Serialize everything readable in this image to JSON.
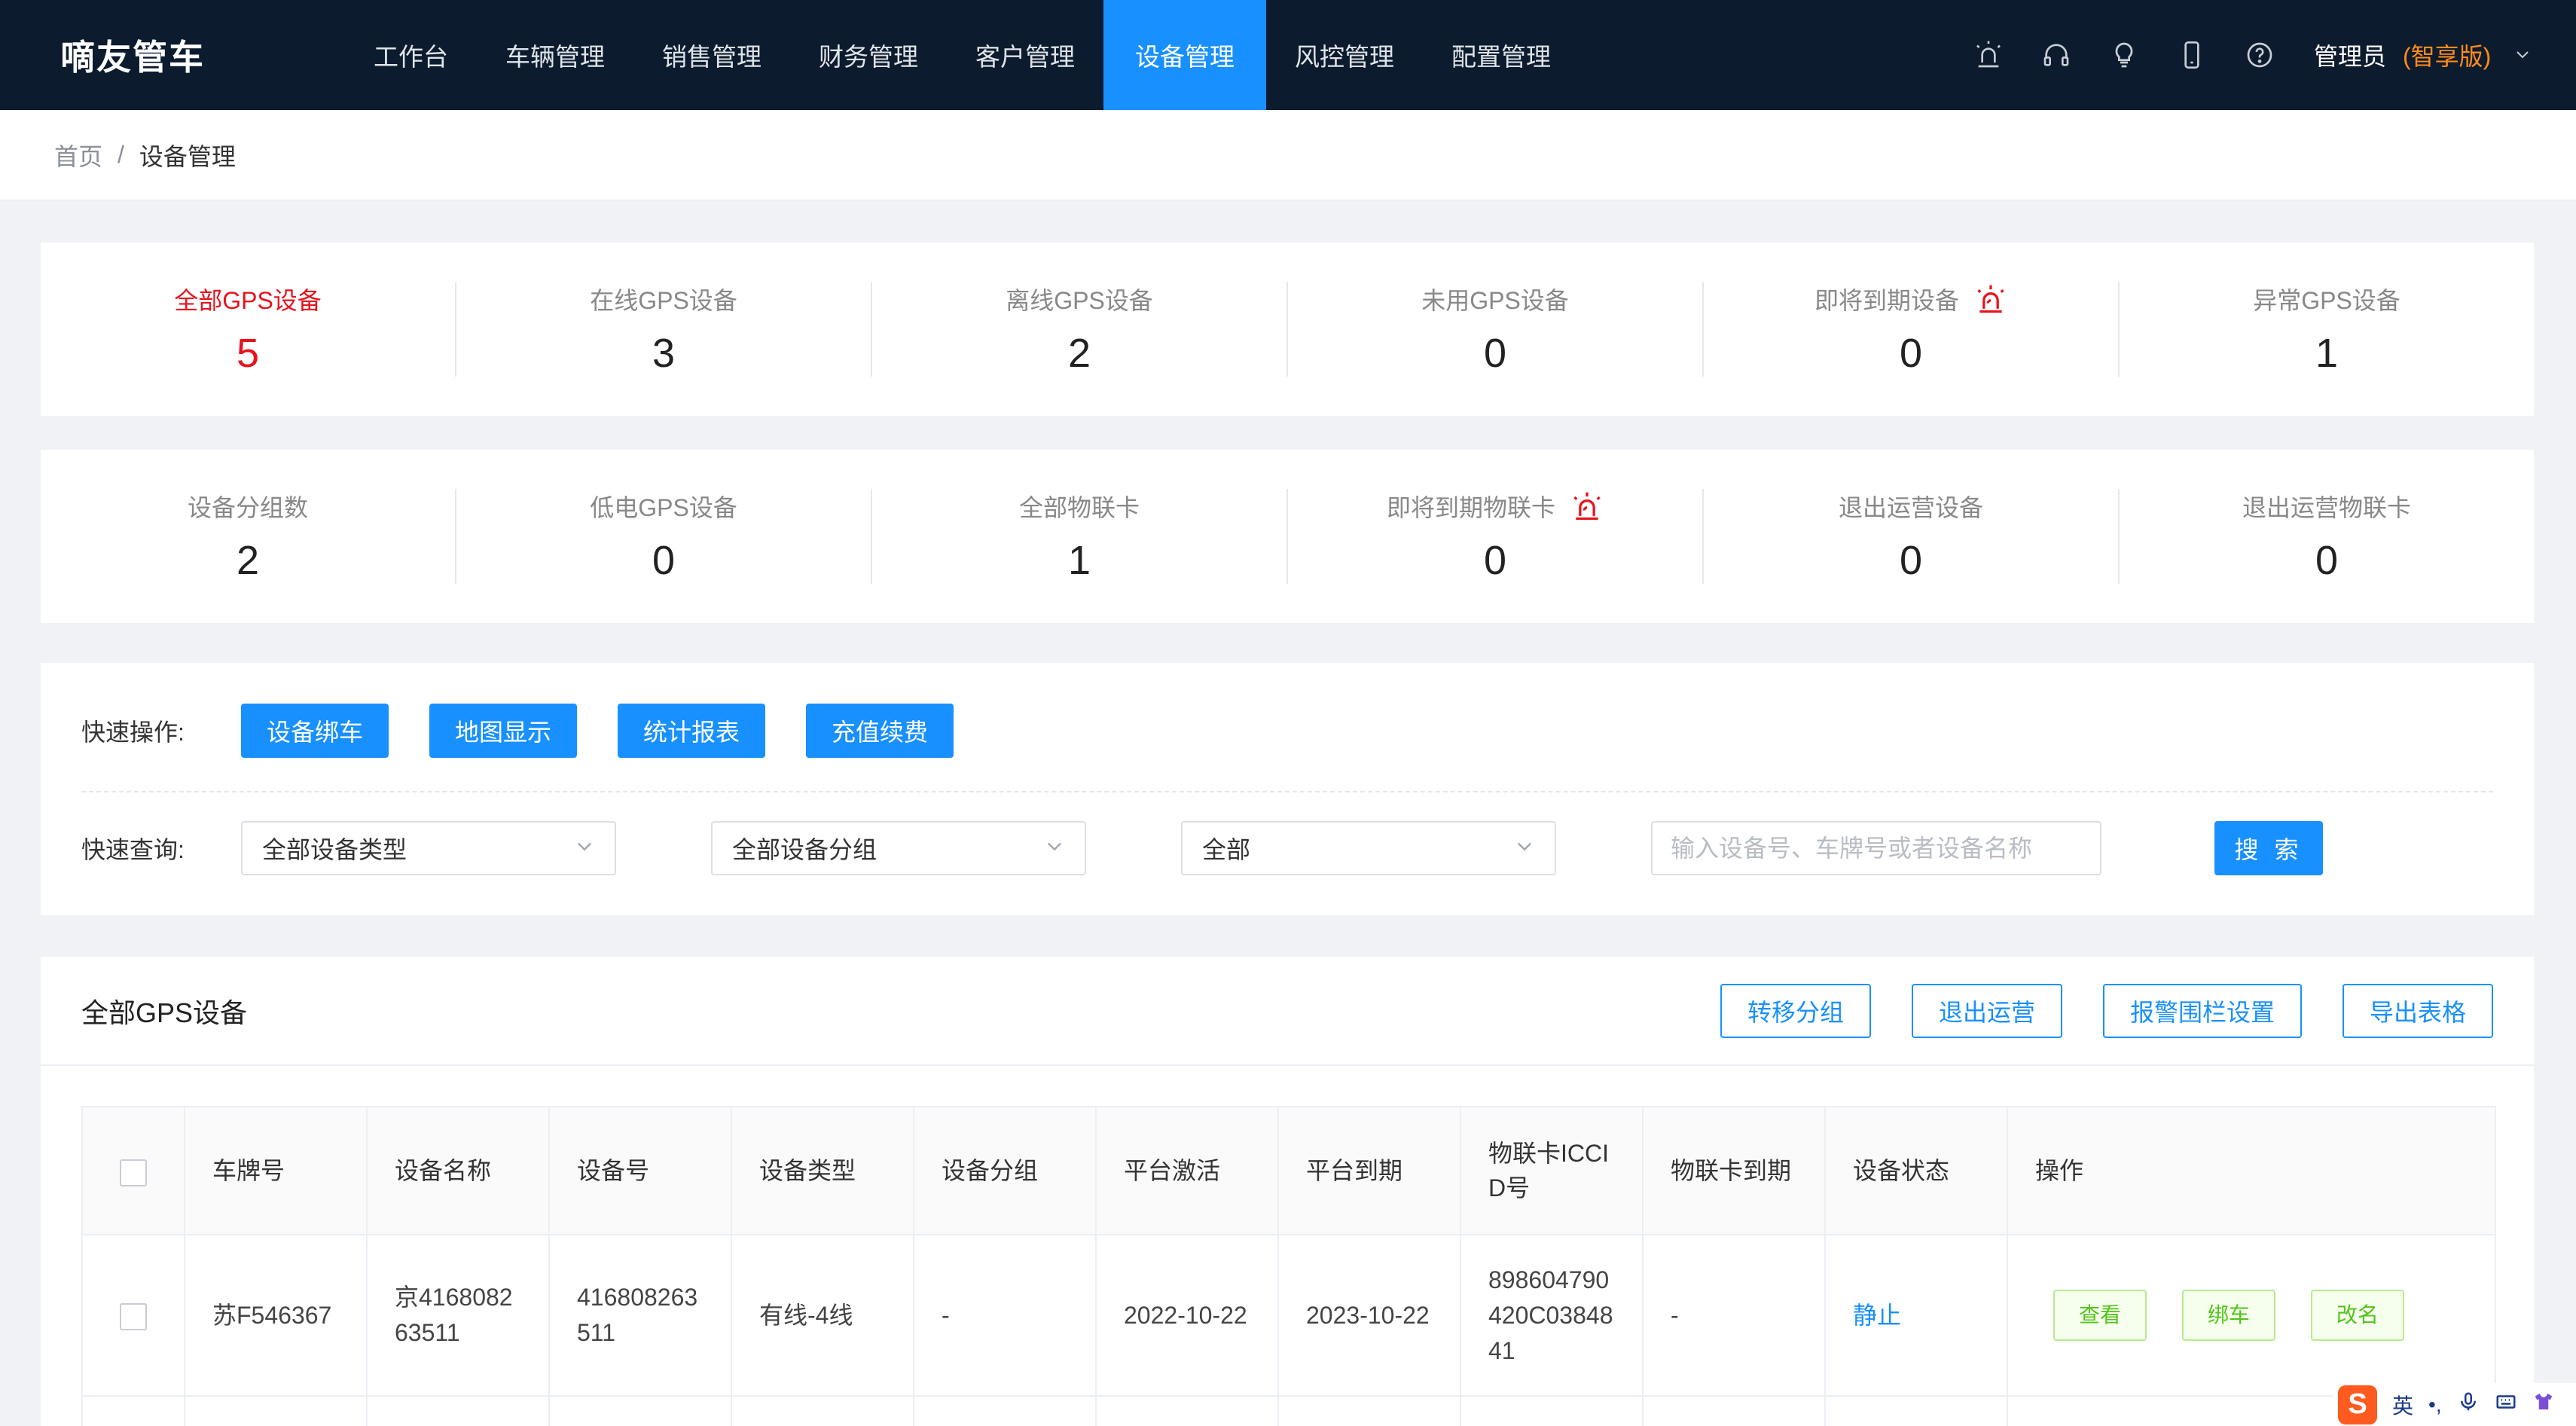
{
  "app": {
    "brand": "嘀友管车"
  },
  "nav": {
    "items": [
      "工作台",
      "车辆管理",
      "销售管理",
      "财务管理",
      "客户管理",
      "设备管理",
      "风控管理",
      "配置管理"
    ],
    "active_index": 5
  },
  "header": {
    "icons": [
      "alarm-icon",
      "headset-icon",
      "lightbulb-icon",
      "phone-icon",
      "help-icon"
    ],
    "user_name": "管理员",
    "edition": "(智享版)"
  },
  "breadcrumb": {
    "home": "首页",
    "separator": "/",
    "current": "设备管理"
  },
  "stats_row1": [
    {
      "label": "全部GPS设备",
      "value": "5",
      "active": true
    },
    {
      "label": "在线GPS设备",
      "value": "3"
    },
    {
      "label": "离线GPS设备",
      "value": "2"
    },
    {
      "label": "未用GPS设备",
      "value": "0"
    },
    {
      "label": "即将到期设备",
      "value": "0",
      "alarm": true
    },
    {
      "label": "异常GPS设备",
      "value": "1"
    }
  ],
  "stats_row2": [
    {
      "label": "设备分组数",
      "value": "2"
    },
    {
      "label": "低电GPS设备",
      "value": "0"
    },
    {
      "label": "全部物联卡",
      "value": "1"
    },
    {
      "label": "即将到期物联卡",
      "value": "0",
      "alarm": true
    },
    {
      "label": "退出运营设备",
      "value": "0"
    },
    {
      "label": "退出运营物联卡",
      "value": "0"
    }
  ],
  "quick_ops": {
    "label": "快速操作:",
    "buttons": [
      "设备绑车",
      "地图显示",
      "统计报表",
      "充值续费"
    ]
  },
  "quick_query": {
    "label": "快速查询:",
    "device_type": "全部设备类型",
    "device_group": "全部设备分组",
    "status": "全部",
    "search_placeholder": "输入设备号、车牌号或者设备名称",
    "search_button": "搜 索"
  },
  "list": {
    "title": "全部GPS设备",
    "actions": [
      "转移分组",
      "退出运营",
      "报警围栏设置",
      "导出表格"
    ],
    "columns": [
      "车牌号",
      "设备名称",
      "设备号",
      "设备类型",
      "设备分组",
      "平台激活",
      "平台到期",
      "物联卡ICCID号",
      "物联卡到期",
      "设备状态",
      "操作"
    ],
    "rows": [
      {
        "plate": "苏F546367",
        "device_name": "京416808263511",
        "device_no": "416808263511",
        "device_type": "有线-4线",
        "group": "-",
        "activated": "2022-10-22",
        "expires": "2023-10-22",
        "iccid": "898604790420C0384841",
        "card_expires": "-",
        "status": "静止",
        "ops": [
          "查看",
          "绑车",
          "改名"
        ]
      }
    ]
  },
  "ime": {
    "lang": "英"
  },
  "colors": {
    "nav_bg": "#0d1b2e",
    "primary": "#1890ff",
    "danger": "#e6141e",
    "edition": "#ff8c1a",
    "success": "#52c41a"
  }
}
